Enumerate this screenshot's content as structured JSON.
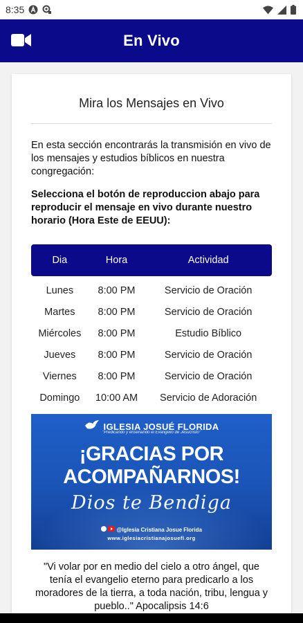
{
  "status_bar": {
    "time": "8:35",
    "left_icons": [
      "app-a-icon",
      "settings-badge-icon"
    ],
    "right_icons": [
      "wifi-icon",
      "signal-icon",
      "battery-icon"
    ]
  },
  "app_bar": {
    "title": "En Vivo",
    "icon": "video-camera-icon",
    "color": "#0a0a8a"
  },
  "card": {
    "title": "Mira los Mensajes en Vivo",
    "intro": "En esta sección encontrarás la transmisión en vivo de los mensajes y estudios bíblicos en nuestra congregación:",
    "instruction": "Selecciona el botón de reproduccion abajo para reproducir el mensaje en vivo durante nuestro horario (Hora Este de EEUU):"
  },
  "schedule": {
    "headers": [
      "Dia",
      "Hora",
      "Actividad"
    ],
    "rows": [
      [
        "Lunes",
        "8:00 PM",
        "Servicio de Oración"
      ],
      [
        "Martes",
        "8:00 PM",
        "Servicio de Oración"
      ],
      [
        "Miércoles",
        "8:00 PM",
        "Estudio Bíblico"
      ],
      [
        "Jueves",
        "8:00 PM",
        "Servicio de Oración"
      ],
      [
        "Viernes",
        "8:00 PM",
        "Servicio de Oración"
      ],
      [
        "Domingo",
        "10:00 AM",
        "Servicio de Adoración"
      ]
    ]
  },
  "banner": {
    "brand": "IGLESIA JOSUÉ FLORIDA",
    "brand_sub": "\"Predicando y enseñando el Evangelio de Jesucristo\"",
    "thanks_line1": "¡GRACIAS POR",
    "thanks_line2": "ACOMPAÑARNOS!",
    "blessing": "Dios te Bendiga",
    "social": "@Iglesia Cristiana Josue Florida",
    "website": "www.iglesiacristianajosuefl.org"
  },
  "verse": "\"Vi volar por en medio del cielo a otro ángel, que tenía el evangelio eterno para predicarlo a los moradores de la tierra, a toda nación, tribu, lengua y pueblo..\" Apocalipsis 14:6"
}
